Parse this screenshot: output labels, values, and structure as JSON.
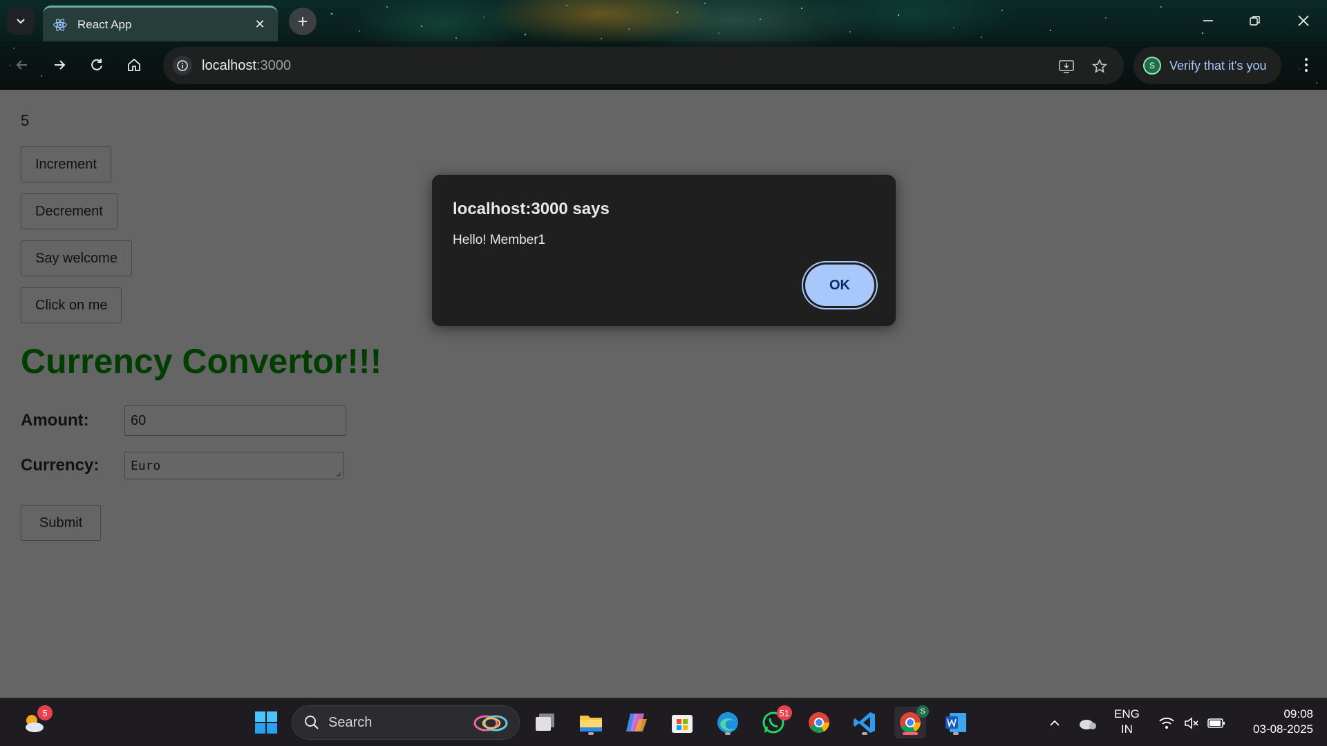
{
  "browser": {
    "tab": {
      "title": "React App"
    },
    "address": {
      "host": "localhost",
      "port": ":3000"
    },
    "profile": {
      "initial": "S",
      "label": "Verify that it's you"
    }
  },
  "page": {
    "count": "5",
    "buttons": {
      "increment": "Increment",
      "decrement": "Decrement",
      "say_welcome": "Say welcome",
      "click_on_me": "Click on me",
      "submit": "Submit"
    },
    "heading": "Currency Convertor!!!",
    "form": {
      "amount_label": "Amount:",
      "amount_value": "60",
      "currency_label": "Currency:",
      "currency_value": "Euro"
    }
  },
  "dialog": {
    "title": "localhost:3000 says",
    "message": "Hello! Member1",
    "ok_label": "OK"
  },
  "taskbar": {
    "weather_badge": "5",
    "search_label": "Search",
    "whatsapp_badge": "51",
    "chrome_profile_badge": "S",
    "language": "ENG",
    "region": "IN",
    "time": "09:08",
    "date": "03-08-2025"
  },
  "colors": {
    "heading": "#003d00",
    "dialog_bg": "#1f1f1f",
    "ok_button": "#a8c7fa",
    "page_dim": "#656565"
  }
}
